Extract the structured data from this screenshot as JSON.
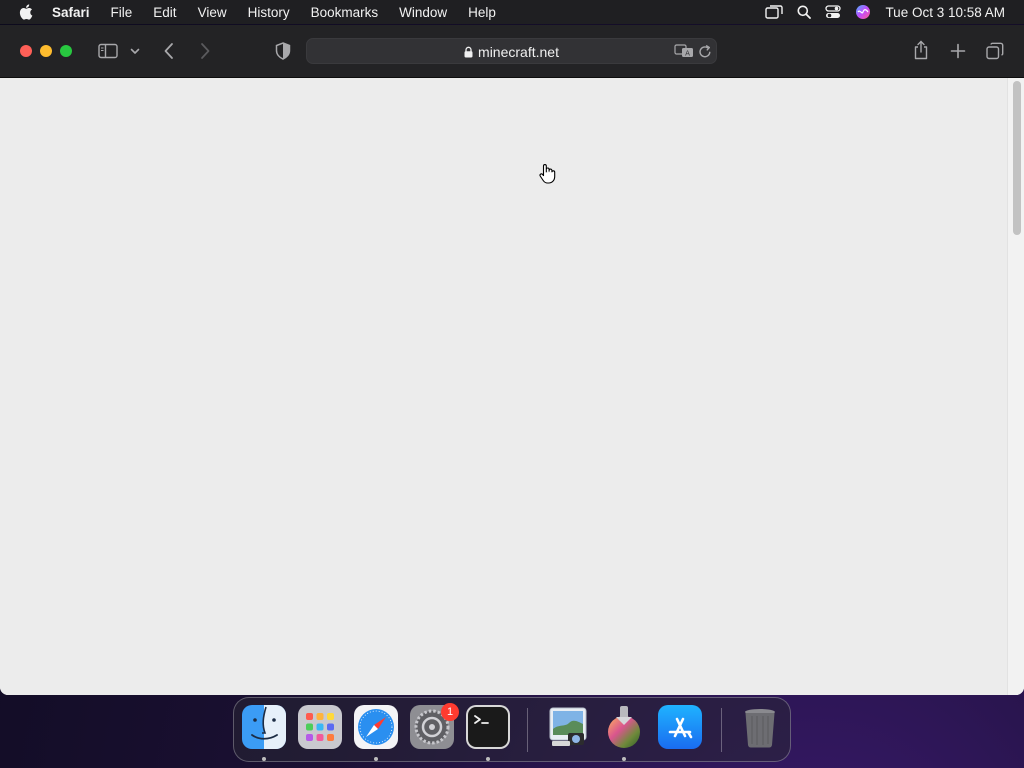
{
  "menubar": {
    "app_name": "Safari",
    "items": [
      "File",
      "Edit",
      "View",
      "History",
      "Bookmarks",
      "Window",
      "Help"
    ],
    "clock": "Tue Oct 3  10:58 AM",
    "status_icons": [
      "screen-mirroring-icon",
      "spotlight-search-icon",
      "control-center-icon",
      "siri-icon"
    ]
  },
  "browser": {
    "url": "minecraft.net",
    "toolbar_icons": [
      "sidebar-icon",
      "chevron-down-icon",
      "back-arrow-icon",
      "forward-arrow-icon",
      "privacy-shield-icon",
      "translate-icon",
      "reload-icon",
      "share-icon",
      "new-tab-icon",
      "tab-overview-icon"
    ]
  },
  "dock": {
    "apps": [
      {
        "name": "Finder",
        "running": true
      },
      {
        "name": "Launchpad",
        "running": false
      },
      {
        "name": "Safari",
        "running": true
      },
      {
        "name": "System Settings",
        "running": false,
        "badge": "1"
      },
      {
        "name": "Terminal",
        "running": true
      },
      {
        "name": "Preview",
        "running": false
      },
      {
        "name": "macOS Sonoma Installer",
        "running": true
      },
      {
        "name": "App Store",
        "running": false
      },
      {
        "name": "Trash",
        "running": false
      }
    ]
  },
  "colors": {
    "menubar_bg": "#1f1f22",
    "toolbar_bg": "#232325",
    "page_bg": "#ececec",
    "close": "#fe5f57",
    "minimize": "#febc2e",
    "maximize": "#28c840",
    "badge": "#ff3b30"
  }
}
